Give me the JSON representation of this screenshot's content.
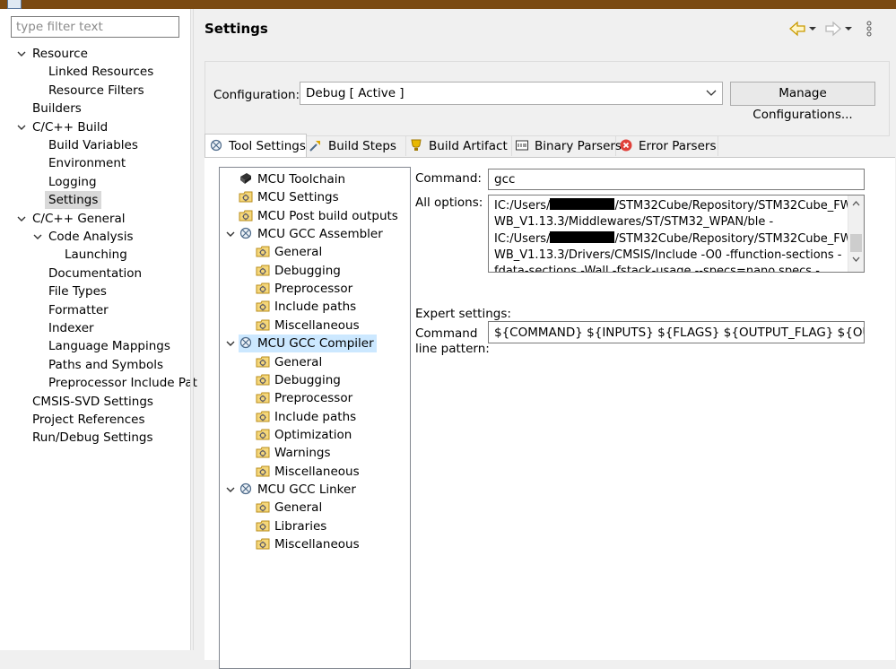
{
  "filter": {
    "placeholder": "type filter text"
  },
  "nav": [
    {
      "label": "Resource",
      "indent": 0,
      "chevron": true
    },
    {
      "label": "Linked Resources",
      "indent": 2
    },
    {
      "label": "Resource Filters",
      "indent": 2
    },
    {
      "label": "Builders",
      "indent": 1
    },
    {
      "label": "C/C++ Build",
      "indent": 0,
      "chevron": true
    },
    {
      "label": "Build Variables",
      "indent": 2
    },
    {
      "label": "Environment",
      "indent": 2
    },
    {
      "label": "Logging",
      "indent": 2
    },
    {
      "label": "Settings",
      "indent": 2,
      "selected": true
    },
    {
      "label": "C/C++ General",
      "indent": 0,
      "chevron": true
    },
    {
      "label": "Code Analysis",
      "indent": 1.5,
      "chevron": true
    },
    {
      "label": "Launching",
      "indent": 3
    },
    {
      "label": "Documentation",
      "indent": 2
    },
    {
      "label": "File Types",
      "indent": 2
    },
    {
      "label": "Formatter",
      "indent": 2
    },
    {
      "label": "Indexer",
      "indent": 2
    },
    {
      "label": "Language Mappings",
      "indent": 2
    },
    {
      "label": "Paths and Symbols",
      "indent": 2
    },
    {
      "label": "Preprocessor Include Pat",
      "indent": 2
    },
    {
      "label": "CMSIS-SVD Settings",
      "indent": 1
    },
    {
      "label": "Project References",
      "indent": 1
    },
    {
      "label": "Run/Debug Settings",
      "indent": 1
    }
  ],
  "header": {
    "title": "Settings"
  },
  "config": {
    "label": "Configuration:",
    "value": "Debug  [ Active ]",
    "manage_label": "Manage Configurations..."
  },
  "tabs": [
    {
      "label": "Tool Settings",
      "icon": "tool-settings-icon",
      "active": true
    },
    {
      "label": "Build Steps",
      "icon": "build-steps-icon"
    },
    {
      "label": "Build Artifact",
      "icon": "build-artifact-icon"
    },
    {
      "label": "Binary Parsers",
      "icon": "binary-parsers-icon"
    },
    {
      "label": "Error Parsers",
      "icon": "error-parsers-icon"
    }
  ],
  "tooltree": [
    {
      "label": "MCU Toolchain",
      "level": 0,
      "icon": "toolchain-icon"
    },
    {
      "label": "MCU Settings",
      "level": 0,
      "icon": "settings-folder-icon"
    },
    {
      "label": "MCU Post build outputs",
      "level": 0,
      "icon": "settings-folder-icon"
    },
    {
      "label": "MCU GCC Assembler",
      "level": 0,
      "icon": "tool-icon",
      "chevron": true
    },
    {
      "label": "General",
      "level": 1,
      "icon": "settings-folder-icon"
    },
    {
      "label": "Debugging",
      "level": 1,
      "icon": "settings-folder-icon"
    },
    {
      "label": "Preprocessor",
      "level": 1,
      "icon": "settings-folder-icon"
    },
    {
      "label": "Include paths",
      "level": 1,
      "icon": "settings-folder-icon"
    },
    {
      "label": "Miscellaneous",
      "level": 1,
      "icon": "settings-folder-icon"
    },
    {
      "label": "MCU GCC Compiler",
      "level": 0,
      "icon": "tool-icon",
      "chevron": true,
      "selected": true
    },
    {
      "label": "General",
      "level": 1,
      "icon": "settings-folder-icon"
    },
    {
      "label": "Debugging",
      "level": 1,
      "icon": "settings-folder-icon"
    },
    {
      "label": "Preprocessor",
      "level": 1,
      "icon": "settings-folder-icon"
    },
    {
      "label": "Include paths",
      "level": 1,
      "icon": "settings-folder-icon"
    },
    {
      "label": "Optimization",
      "level": 1,
      "icon": "settings-folder-icon"
    },
    {
      "label": "Warnings",
      "level": 1,
      "icon": "settings-folder-icon"
    },
    {
      "label": "Miscellaneous",
      "level": 1,
      "icon": "settings-folder-icon"
    },
    {
      "label": "MCU GCC Linker",
      "level": 0,
      "icon": "tool-icon",
      "chevron": true
    },
    {
      "label": "General",
      "level": 1,
      "icon": "settings-folder-icon"
    },
    {
      "label": "Libraries",
      "level": 1,
      "icon": "settings-folder-icon"
    },
    {
      "label": "Miscellaneous",
      "level": 1,
      "icon": "settings-folder-icon"
    }
  ],
  "details": {
    "command_label": "Command:",
    "command_value": "gcc",
    "all_options_label": "All options:",
    "options_lines": [
      [
        "IC:/Users/",
        "/STM32Cube/Repository/STM32Cube_FW_"
      ],
      [
        "WB_V1.13.3/Middlewares/ST/STM32_WPAN/ble -",
        ""
      ],
      [
        "IC:/Users/",
        "/STM32Cube/Repository/STM32Cube_FW_"
      ],
      [
        "WB_V1.13.3/Drivers/CMSIS/Include -O0 -ffunction-sections -",
        ""
      ],
      [
        "fdata-sections -Wall -fstack-usage --specs=nano.specs -",
        ""
      ]
    ],
    "expert_label": "Expert settings:",
    "pattern_label_1": "Command",
    "pattern_label_2": "line pattern:",
    "pattern_value": "${COMMAND} ${INPUTS} ${FLAGS} ${OUTPUT_FLAG} ${OUTPUT_PREFIX}${OUTPUT}"
  }
}
